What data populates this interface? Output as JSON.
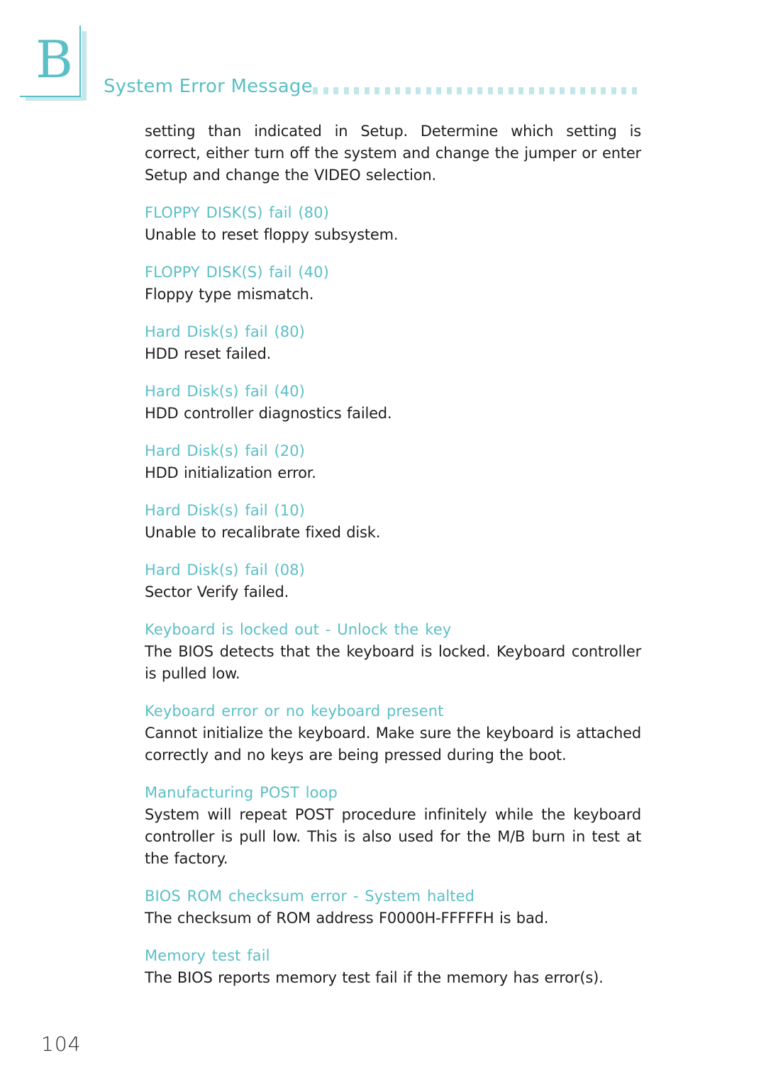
{
  "chapter": {
    "letter": "B",
    "title": "System Error Message"
  },
  "intro_text": "setting than indicated in Setup. Determine which setting is correct, either turn off the system and change the jumper or enter Setup and change the VIDEO selection.",
  "entries": [
    {
      "heading": "FLOPPY DISK(S) fail (80)",
      "description": "Unable to reset floppy subsystem."
    },
    {
      "heading": "FLOPPY DISK(S) fail (40)",
      "description": "Floppy type mismatch."
    },
    {
      "heading": "Hard Disk(s) fail (80)",
      "description": "HDD reset failed."
    },
    {
      "heading": "Hard Disk(s) fail (40)",
      "description": "HDD controller diagnostics failed."
    },
    {
      "heading": "Hard Disk(s) fail (20)",
      "description": "HDD initialization error."
    },
    {
      "heading": "Hard Disk(s) fail (10)",
      "description": "Unable to recalibrate fixed disk."
    },
    {
      "heading": "Hard Disk(s) fail (08)",
      "description": "Sector Verify failed."
    },
    {
      "heading": "Keyboard is locked out - Unlock the key",
      "description": "The BIOS detects that the keyboard is locked. Keyboard controller is pulled low."
    },
    {
      "heading": "Keyboard error or no keyboard present",
      "description": "Cannot initialize the keyboard. Make sure the keyboard is attached correctly and no keys are being pressed during the boot."
    },
    {
      "heading": "Manufacturing POST loop",
      "description": "System will repeat POST procedure infinitely while the keyboard controller is pull low. This is also used for the M/B burn in test at the factory."
    },
    {
      "heading": "BIOS ROM checksum error - System halted",
      "description": "The checksum of ROM address F0000H-FFFFFH is bad."
    },
    {
      "heading": "Memory test fail",
      "description": "The BIOS reports memory test fail if the memory has error(s)."
    }
  ],
  "page_number": "104",
  "colors": {
    "accent": "#5bbfc6",
    "accent_light": "#c4e7ea",
    "text": "#1e1e1e"
  }
}
